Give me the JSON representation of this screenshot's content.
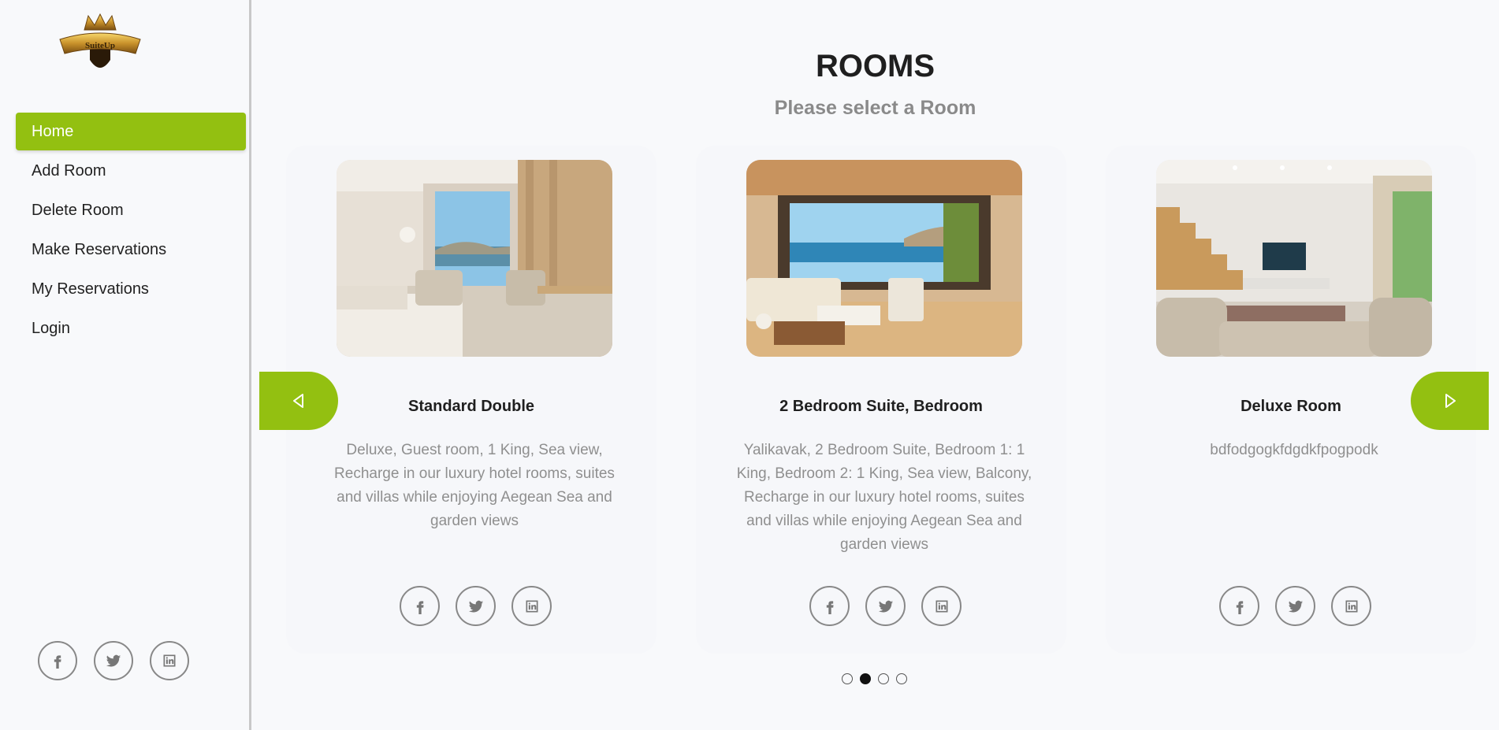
{
  "sidebar": {
    "logo_text": "SuiteUp",
    "items": [
      {
        "label": "Home",
        "active": true
      },
      {
        "label": "Add Room",
        "active": false
      },
      {
        "label": "Delete Room",
        "active": false
      },
      {
        "label": "Make Reservations",
        "active": false
      },
      {
        "label": "My Reservations",
        "active": false
      },
      {
        "label": "Login",
        "active": false
      }
    ],
    "social": [
      "facebook-icon",
      "twitter-icon",
      "linkedin-icon"
    ]
  },
  "header": {
    "title": "ROOMS",
    "subtitle": "Please select a Room"
  },
  "rooms": [
    {
      "name": "Standard Double",
      "description": "Deluxe, Guest room, 1 King, Sea view, Recharge in our luxury hotel rooms, suites and villas while enjoying Aegean Sea and garden views"
    },
    {
      "name": "2 Bedroom Suite, Bedroom",
      "description": "Yalikavak, 2 Bedroom Suite, Bedroom 1: 1 King, Bedroom 2: 1 King, Sea view, Balcony, Recharge in our luxury hotel rooms, suites and villas while enjoying Aegean Sea and garden views"
    },
    {
      "name": "Deluxe Room",
      "description": "bdfodgogkfdgdkfpogpodk"
    }
  ],
  "carousel": {
    "prev_icon": "chevron-left-icon",
    "next_icon": "chevron-right-icon",
    "dot_count": 4,
    "active_dot": 2
  },
  "colors": {
    "accent": "#93c011",
    "background": "#f8f9fb"
  }
}
